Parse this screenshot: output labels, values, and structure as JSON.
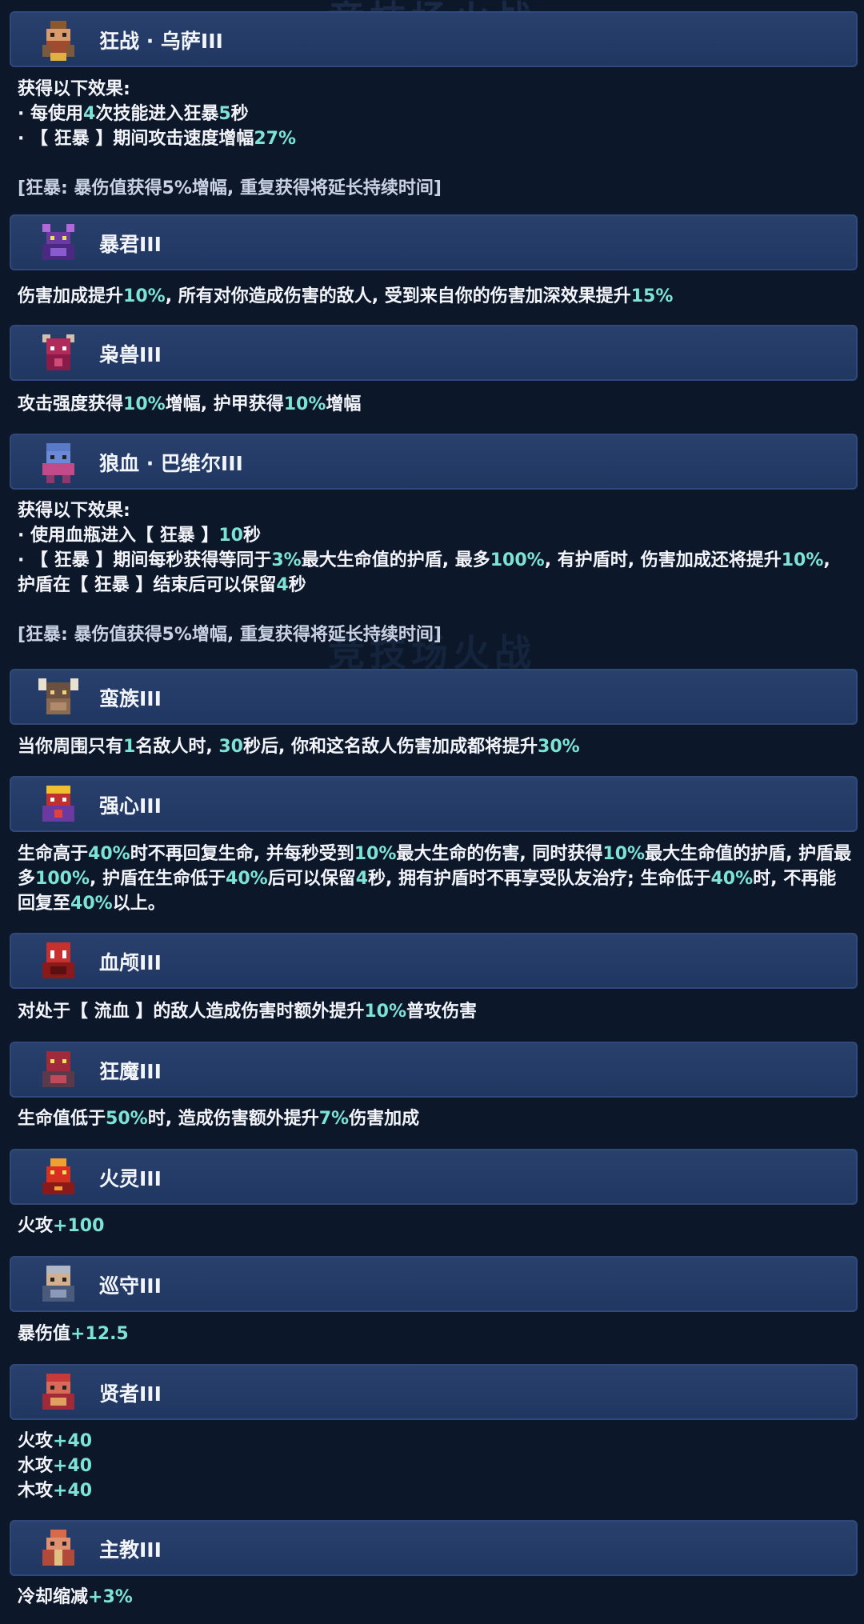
{
  "background": {
    "title": "竞技场火战",
    "title_repeat": "竞技场火战"
  },
  "colors": {
    "highlight": "#7de3d4",
    "bar": "#243c68",
    "text": "#f3f5fa",
    "bg": "#0c1729"
  },
  "entries": [
    {
      "title": "狂战 · 乌萨III",
      "icon": "orc-berserker-portrait",
      "lines": [
        "获得以下效果:",
        "· 每使用4次技能进入狂暴5秒",
        "· 【 狂暴 】期间攻击速度增幅27%",
        "",
        "[狂暴: 暴伤值获得5%增幅, 重复获得将延长持续时间]"
      ]
    },
    {
      "title": "暴君III",
      "icon": "tyrant-portrait",
      "lines": [
        "伤害加成提升10%, 所有对你造成伤害的敌人, 受到来自你的伤害加深效果提升15%"
      ]
    },
    {
      "title": "枭兽III",
      "icon": "beast-portrait",
      "lines": [
        "攻击强度获得10%增幅, 护甲获得10%增幅"
      ]
    },
    {
      "title": "狼血 · 巴维尔III",
      "icon": "wolfblood-portrait",
      "lines": [
        "获得以下效果:",
        "· 使用血瓶进入【 狂暴 】10秒",
        "· 【 狂暴 】期间每秒获得等同于3%最大生命值的护盾, 最多100%, 有护盾时, 伤害加成还将提升10%, 护盾在【 狂暴 】结束后可以保留4秒",
        "",
        "[狂暴: 暴伤值获得5%增幅, 重复获得将延长持续时间]"
      ]
    },
    {
      "title": "蛮族III",
      "icon": "barbarian-portrait",
      "lines": [
        "当你周围只有1名敌人时, 30秒后, 你和这名敌人伤害加成都将提升30%"
      ]
    },
    {
      "title": "强心III",
      "icon": "strongheart-portrait",
      "lines": [
        "生命高于40%时不再回复生命, 并每秒受到10%最大生命的伤害, 同时获得10%最大生命值的护盾, 护盾最多100%, 护盾在生命低于40%后可以保留4秒, 拥有护盾时不再享受队友治疗; 生命低于40%时, 不再能回复至40%以上。"
      ]
    },
    {
      "title": "血颅III",
      "icon": "bloodskull-portrait",
      "lines": [
        "对处于【 流血 】的敌人造成伤害时额外提升10%普攻伤害"
      ]
    },
    {
      "title": "狂魔III",
      "icon": "madfiend-portrait",
      "lines": [
        "生命值低于50%时, 造成伤害额外提升7%伤害加成"
      ]
    },
    {
      "title": "火灵III",
      "icon": "firespirit-portrait",
      "lines": [
        "火攻+100"
      ]
    },
    {
      "title": "巡守III",
      "icon": "warden-portrait",
      "lines": [
        "暴伤值+12.5"
      ]
    },
    {
      "title": "贤者III",
      "icon": "sage-portrait",
      "lines": [
        "火攻+40",
        "水攻+40",
        "木攻+40"
      ]
    },
    {
      "title": "主教III",
      "icon": "bishop-portrait",
      "lines": [
        "冷却缩减+3%"
      ]
    }
  ]
}
